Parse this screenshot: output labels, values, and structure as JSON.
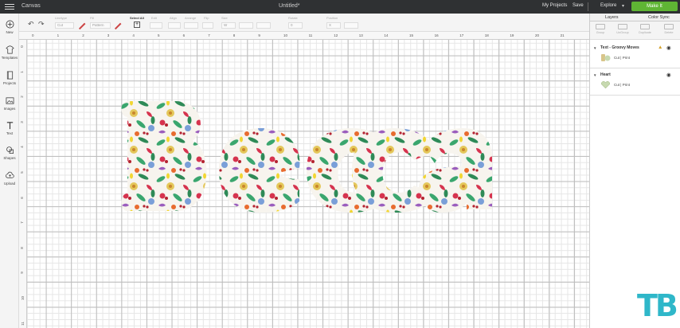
{
  "topbar": {
    "app_title": "Canvas",
    "doc_title": "Untitled*",
    "my_projects": "My Projects",
    "save": "Save",
    "machine": "Explore",
    "make_it": "Make It"
  },
  "toolbar": {
    "linetype_label": "Linetype",
    "linetype_value": "Cut",
    "fill_label": "Fill",
    "fill_value": "Pattern",
    "select_all_label": "Select All",
    "edit_label": "Edit",
    "align_label": "Align",
    "arrange_label": "Arrange",
    "flip_label": "Flip",
    "size_label": "Size",
    "size_value": "W",
    "rotate_label": "Rotate",
    "rotate_value": "0",
    "position_label": "Position",
    "position_value": "X"
  },
  "leftrail": {
    "items": [
      {
        "label": "New",
        "icon": "plus-icon"
      },
      {
        "label": "Templates",
        "icon": "shirt-icon"
      },
      {
        "label": "Projects",
        "icon": "book-icon"
      },
      {
        "label": "Images",
        "icon": "image-icon"
      },
      {
        "label": "Text",
        "icon": "text-icon"
      },
      {
        "label": "Shapes",
        "icon": "shapes-icon"
      },
      {
        "label": "Upload",
        "icon": "cloud-upload-icon"
      }
    ]
  },
  "ruler": {
    "top": [
      "0",
      "1",
      "2",
      "3",
      "4",
      "5",
      "6",
      "7",
      "8",
      "9",
      "10",
      "11",
      "12",
      "13",
      "14",
      "15",
      "16",
      "17",
      "18",
      "19",
      "20",
      "21"
    ],
    "left": [
      "0",
      "1",
      "2",
      "3",
      "4",
      "5",
      "6",
      "7",
      "8",
      "9",
      "10",
      "11"
    ]
  },
  "design": {
    "text": "Becca",
    "fill_colors": [
      "#e4c75a",
      "#3aa66e",
      "#d6334e",
      "#7a9fd8",
      "#9a5dbd",
      "#e86b2f",
      "#f2d632"
    ]
  },
  "rpanel": {
    "tabs": [
      "Layers",
      "Color Sync"
    ],
    "actions": [
      "Group",
      "UnGroup",
      "Duplicate",
      "Delete"
    ],
    "layers": [
      {
        "name": "Text - Groovy Moves",
        "op": "Cut",
        "sep": "|",
        "mode": "Print",
        "warning": true
      },
      {
        "name": "Heart",
        "op": "Cut",
        "sep": "|",
        "mode": "Print",
        "warning": false
      }
    ]
  },
  "watermark": "TB",
  "colors": {
    "topbar": "#2f3133",
    "make_it": "#5fb534",
    "watermark": "#2fb7c9"
  }
}
